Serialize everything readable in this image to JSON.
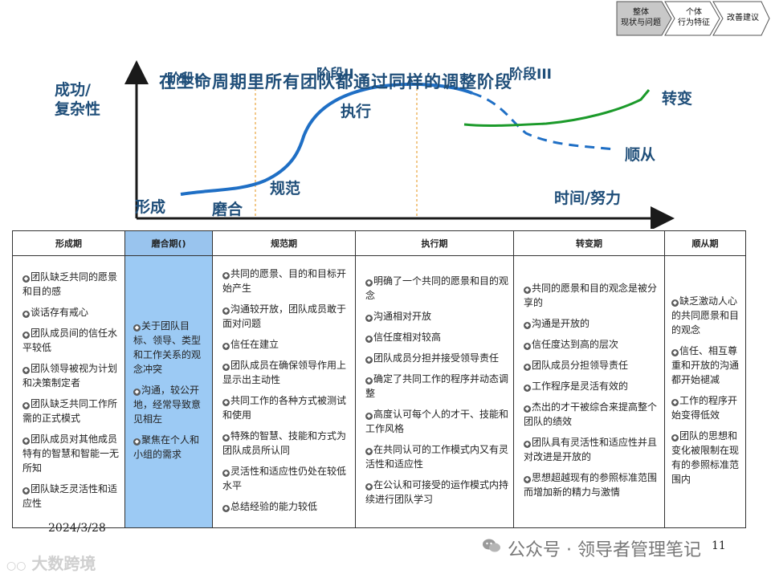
{
  "breadcrumb": {
    "items": [
      {
        "lines": [
          "整体",
          "现状与问题"
        ],
        "active": true
      },
      {
        "lines": [
          "个体",
          "行为特征"
        ],
        "active": false
      },
      {
        "lines": [
          "改善建议"
        ],
        "active": false
      }
    ]
  },
  "figure": {
    "title": "在生命周期里所有团队都通过同样的调整阶段",
    "y_axis_label": [
      "成功/",
      "复杂性"
    ],
    "x_axis_label": "时间/努力",
    "phase_labels": [
      "阶段I",
      "阶段II",
      "阶段III"
    ],
    "stage_labels": {
      "forming": "形成",
      "storming": "磨合",
      "norming": "规范",
      "performing": "执行",
      "transforming": "转变",
      "conforming": "顺从"
    },
    "colors": {
      "axis": "#1a1a1a",
      "curve": "#1f6fc5",
      "divider": "#e8a33d",
      "green": "#1b9a2a",
      "label": "#1f4e79"
    }
  },
  "table": {
    "headers": [
      "形成期",
      "磨合期()",
      "规范期",
      "执行期",
      "转变期",
      "顺从期"
    ],
    "highlight_index": 1,
    "highlight_color": "#9ccaf4",
    "columns": [
      [
        "团队缺乏共同的愿景和目的感",
        "谈话存有戒心",
        "团队成员间的信任水平较低",
        "团队领导被视为计划和决策制定者",
        "团队缺乏共同工作所需的正式模式",
        "团队成员对其他成员特有的智慧和智能一无所知",
        "团队缺乏灵活性和适应性"
      ],
      [
        "关于团队目标、领导、类型和工作关系的观念冲突",
        "沟通，较公开地，经常导致意见相左",
        "聚焦在个人和小组的需求"
      ],
      [
        "共同的愿景、目的和目标开始产生",
        "沟通较开放，团队成员敢于面对问题",
        "信任在建立",
        "团队成员在确保领导作用上显示出主动性",
        "共同工作的各种方式被测试和使用",
        "特殊的智慧、技能和方式为团队成员所认同",
        "灵活性和适应性仍处在较低水平",
        "总结经验的能力较低"
      ],
      [
        "明确了一个共同的愿景和目的观念",
        "沟通相对开放",
        "信任度相对较高",
        "团队成员分担并接受领导责任",
        "确定了共同工作的程序并动态调整",
        "高度认可每个人的才干、技能和工作风格",
        "在共同认可的工作模式内又有灵活性和适应性",
        "在公认和可接受的运作模式内持续进行团队学习"
      ],
      [
        "共同的愿景和目的观念是被分享的",
        "沟通是开放的",
        "信任度达到高的层次",
        "团队成员分担领导责任",
        "工作程序是灵活有效的",
        "杰出的才干被综合来提高整个团队的绩效",
        "团队具有灵活性和适应性并且对改进是开放的",
        "思想超越现有的参照标准范围而增加新的精力与激情"
      ],
      [
        "缺乏激动人心的共同愿景和目的观念",
        "信任、相互尊重和开放的沟通都开始褪减",
        "工作的程序开始变得低效",
        "团队的思想和变化被限制在现有的参照标准范围内"
      ]
    ]
  },
  "footer": {
    "date": "2024/3/28",
    "page": "11",
    "watermark": "公众号 · 领导者管理笔记",
    "logo": "大数跨境"
  }
}
